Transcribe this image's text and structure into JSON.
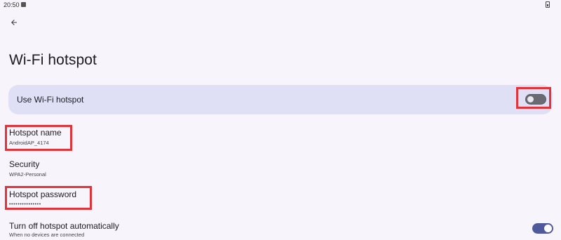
{
  "status_bar": {
    "time": "20:50"
  },
  "header": {
    "back_icon": "arrow-back-icon",
    "title": "Wi-Fi hotspot"
  },
  "main_toggle": {
    "label": "Use Wi-Fi hotspot",
    "state": "off"
  },
  "settings": {
    "hotspot_name": {
      "title": "Hotspot name",
      "value": "AndroidAP_4174"
    },
    "security": {
      "title": "Security",
      "value": "WPA2-Personal"
    },
    "hotspot_password": {
      "title": "Hotspot password",
      "value": "•••••••••••••••"
    },
    "auto_off": {
      "title": "Turn off hotspot automatically",
      "subtitle": "When no devices are connected",
      "state": "on"
    }
  },
  "colors": {
    "background": "#f7f5fb",
    "card": "#dfe0f6",
    "switch_on": "#4e5a9c",
    "switch_off": "#6b6a72",
    "highlight": "#e2333b"
  }
}
